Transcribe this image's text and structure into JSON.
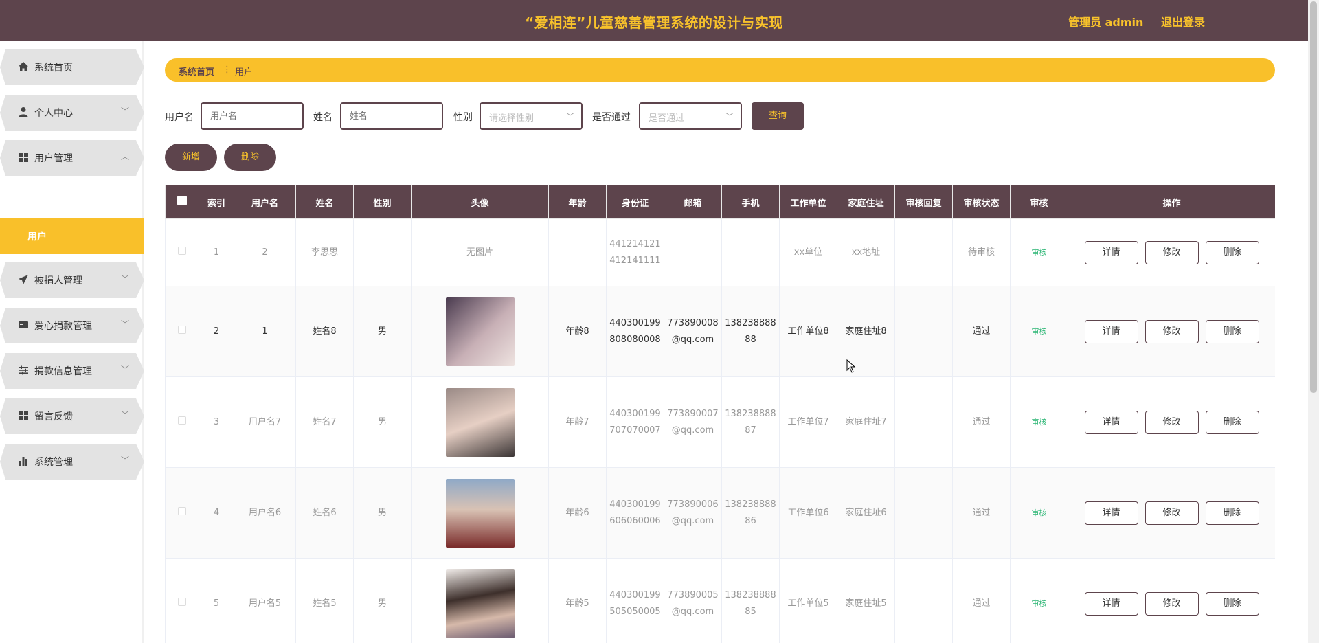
{
  "header": {
    "title": "“爱相连”儿童慈善管理系统的设计与实现",
    "user": "管理员 admin",
    "logout": "退出登录",
    "bg_color": "#5d444c",
    "accent_color": "#f8c22b"
  },
  "sidebar": {
    "items": [
      {
        "label": "系统首页",
        "icon": "home-icon"
      },
      {
        "label": "个人中心",
        "icon": "user-icon"
      },
      {
        "label": "用户管理",
        "icon": "grid-icon"
      },
      {
        "label": "被捐人管理",
        "icon": "send-icon"
      },
      {
        "label": "爱心捐款管理",
        "icon": "card-icon"
      },
      {
        "label": "捐款信息管理",
        "icon": "sliders-icon"
      },
      {
        "label": "留言反馈",
        "icon": "grid-icon"
      },
      {
        "label": "系统管理",
        "icon": "bar-chart-icon"
      }
    ],
    "active_sub": "用户"
  },
  "breadcrumb": {
    "home": "系统首页",
    "current": "用户"
  },
  "search": {
    "username_label": "用户名",
    "username_placeholder": "用户名",
    "name_label": "姓名",
    "name_placeholder": "姓名",
    "gender_label": "性别",
    "gender_placeholder": "请选择性别",
    "approved_label": "是否通过",
    "approved_placeholder": "是否通过",
    "query_button": "查询"
  },
  "actions": {
    "add": "新增",
    "delete": "删除"
  },
  "table": {
    "headers": [
      "索引",
      "用户名",
      "姓名",
      "性别",
      "头像",
      "年龄",
      "身份证",
      "邮箱",
      "手机",
      "工作单位",
      "家庭住址",
      "审核回复",
      "审核状态",
      "审核",
      "操作"
    ],
    "op_labels": {
      "detail": "详情",
      "edit": "修改",
      "delete": "删除"
    },
    "rows": [
      {
        "index": "1",
        "username": "2",
        "name": "李思思",
        "gender": "",
        "avatar": "无图片",
        "age": "",
        "id_card": "441214121412141111",
        "email": "",
        "phone": "",
        "work": "xx单位",
        "address": "xx地址",
        "reply": "",
        "status": "待审核",
        "audit": "审核"
      },
      {
        "index": "2",
        "username": "1",
        "name": "姓名8",
        "gender": "男",
        "avatar": "",
        "age": "年龄8",
        "id_card": "440300199808080008",
        "email": "773890008@qq.com",
        "phone": "13823888888",
        "work": "工作单位8",
        "address": "家庭住址8",
        "reply": "",
        "status": "通过",
        "audit": "审核"
      },
      {
        "index": "3",
        "username": "用户名7",
        "name": "姓名7",
        "gender": "男",
        "avatar": "",
        "age": "年龄7",
        "id_card": "440300199707070007",
        "email": "773890007@qq.com",
        "phone": "13823888887",
        "work": "工作单位7",
        "address": "家庭住址7",
        "reply": "",
        "status": "通过",
        "audit": "审核"
      },
      {
        "index": "4",
        "username": "用户名6",
        "name": "姓名6",
        "gender": "男",
        "avatar": "",
        "age": "年龄6",
        "id_card": "440300199606060006",
        "email": "773890006@qq.com",
        "phone": "13823888886",
        "work": "工作单位6",
        "address": "家庭住址6",
        "reply": "",
        "status": "通过",
        "audit": "审核"
      },
      {
        "index": "5",
        "username": "用户名5",
        "name": "姓名5",
        "gender": "男",
        "avatar": "",
        "age": "年龄5",
        "id_card": "440300199505050005",
        "email": "773890005@qq.com",
        "phone": "13823888885",
        "work": "工作单位5",
        "address": "家庭住址5",
        "reply": "",
        "status": "通过",
        "audit": "审核"
      }
    ]
  }
}
